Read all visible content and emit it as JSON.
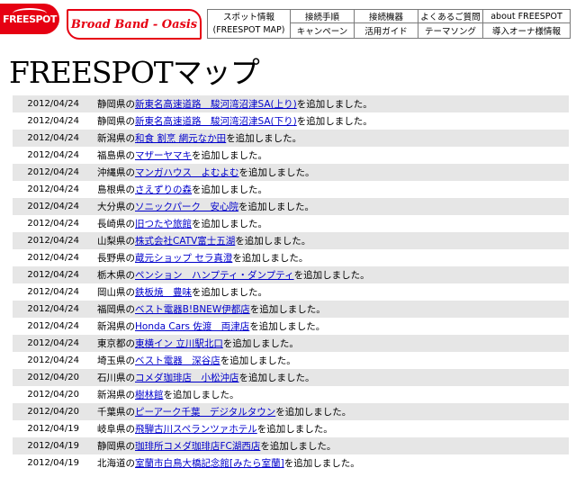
{
  "header": {
    "logo_text": "FREESPOT",
    "brand_text": "Broad Band - Oasis",
    "nav": {
      "spot_info_line1": "スポット情報",
      "spot_info_line2": "(FREESPOT MAP)",
      "connect_steps": "接続手順",
      "campaign": "キャンペーン",
      "devices": "接続機器",
      "guide": "活用ガイド",
      "faq": "よくあるご質問",
      "theme_song": "テーマソング",
      "about": "about FREESPOT",
      "owner_info": "導入オーナ様情報"
    }
  },
  "page_title": "FREESPOTマップ",
  "colors": {
    "accent_red": "#e60012",
    "link_blue": "#0000cc",
    "row_alt": "#e6e6e6"
  },
  "entries": [
    {
      "date": "2012/04/24",
      "prefecture": "静岡県の",
      "name": "新東名高速道路　駿河湾沼津SA(上り)",
      "suffix": "を追加しました。"
    },
    {
      "date": "2012/04/24",
      "prefecture": "静岡県の",
      "name": "新東名高速道路　駿河湾沼津SA(下り)",
      "suffix": "を追加しました。"
    },
    {
      "date": "2012/04/24",
      "prefecture": "新潟県の",
      "name": "和食 割烹 網元なか田",
      "suffix": "を追加しました。"
    },
    {
      "date": "2012/04/24",
      "prefecture": "福島県の",
      "name": "マザーヤマキ",
      "suffix": "を追加しました。"
    },
    {
      "date": "2012/04/24",
      "prefecture": "沖縄県の",
      "name": "マンガハウス　よむよむ",
      "suffix": "を追加しました。"
    },
    {
      "date": "2012/04/24",
      "prefecture": "島根県の",
      "name": "さえずりの森",
      "suffix": "を追加しました。"
    },
    {
      "date": "2012/04/24",
      "prefecture": "大分県の",
      "name": "ソニックパーク　安心院",
      "suffix": "を追加しました。"
    },
    {
      "date": "2012/04/24",
      "prefecture": "長崎県の",
      "name": "旧つたや旅館",
      "suffix": "を追加しました。"
    },
    {
      "date": "2012/04/24",
      "prefecture": "山梨県の",
      "name": "株式会社CATV富士五湖",
      "suffix": "を追加しました。"
    },
    {
      "date": "2012/04/24",
      "prefecture": "長野県の",
      "name": "蔵元ショップ セラ真澄",
      "suffix": "を追加しました。"
    },
    {
      "date": "2012/04/24",
      "prefecture": "栃木県の",
      "name": "ペンション　ハンプティ・ダンプティ",
      "suffix": "を追加しました。"
    },
    {
      "date": "2012/04/24",
      "prefecture": "岡山県の",
      "name": "鉄板焼　豊味",
      "suffix": "を追加しました。"
    },
    {
      "date": "2012/04/24",
      "prefecture": "福岡県の",
      "name": "ベスト電器B!BNEW伊都店",
      "suffix": "を追加しました。"
    },
    {
      "date": "2012/04/24",
      "prefecture": "新潟県の",
      "name": "Honda Cars 佐渡　両津店",
      "suffix": "を追加しました。"
    },
    {
      "date": "2012/04/24",
      "prefecture": "東京都の",
      "name": "東横イン 立川駅北口",
      "suffix": "を追加しました。"
    },
    {
      "date": "2012/04/24",
      "prefecture": "埼玉県の",
      "name": "ベスト電器　深谷店",
      "suffix": "を追加しました。"
    },
    {
      "date": "2012/04/20",
      "prefecture": "石川県の",
      "name": "コメダ珈琲店　小松沖店",
      "suffix": "を追加しました。"
    },
    {
      "date": "2012/04/20",
      "prefecture": "新潟県の",
      "name": "樹林館",
      "suffix": "を追加しました。"
    },
    {
      "date": "2012/04/20",
      "prefecture": "千葉県の",
      "name": "ピーアーク千葉　デジタルタウン",
      "suffix": "を追加しました。"
    },
    {
      "date": "2012/04/19",
      "prefecture": "岐阜県の",
      "name": "飛騨古川スペランツァホテル",
      "suffix": "を追加しました。"
    },
    {
      "date": "2012/04/19",
      "prefecture": "静岡県の",
      "name": "珈琲所コメダ珈琲店FC湖西店",
      "suffix": "を追加しました。"
    },
    {
      "date": "2012/04/19",
      "prefecture": "北海道の",
      "name": "室蘭市白鳥大橋記念館[みたら室蘭]",
      "suffix": "を追加しました。"
    }
  ]
}
